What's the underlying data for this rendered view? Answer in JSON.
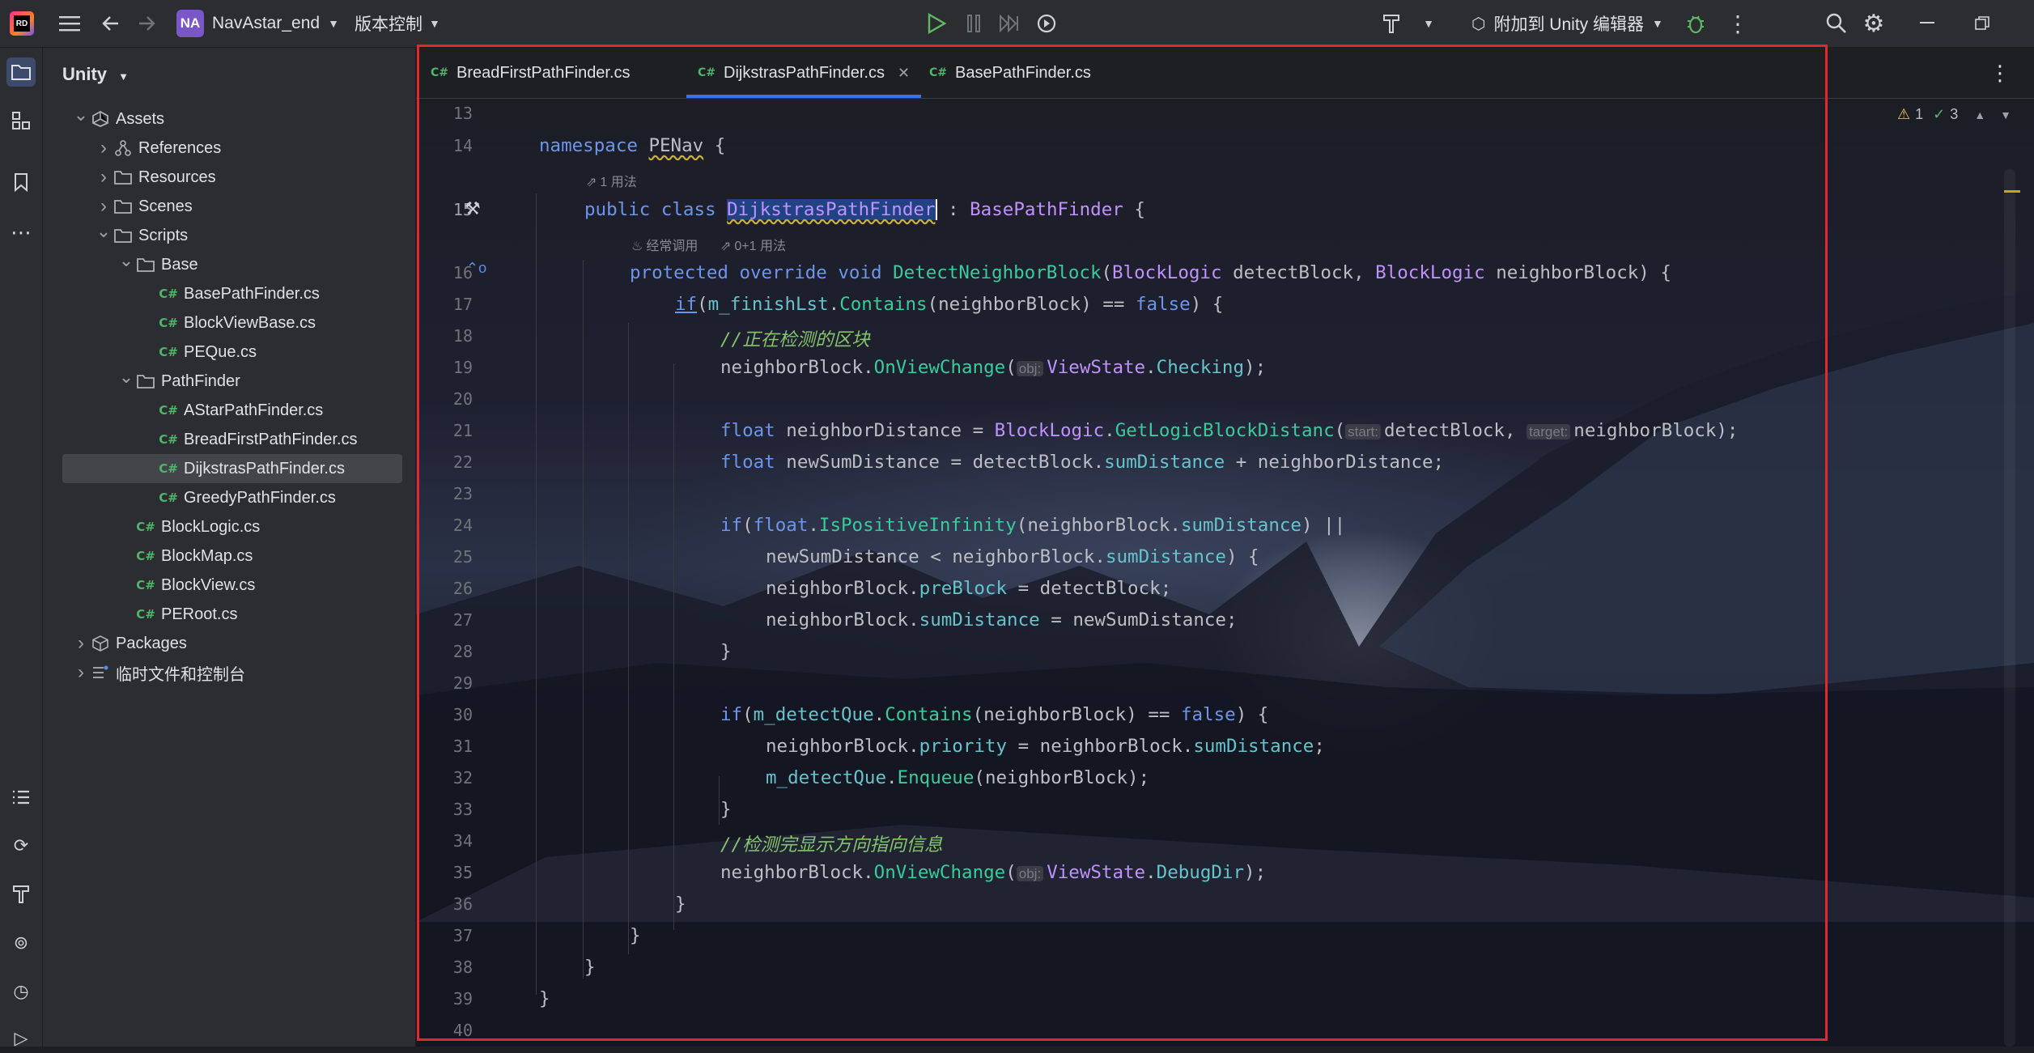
{
  "titlebar": {
    "logo_text": "RD",
    "project_badge": "NA",
    "project_name": "NavAstar_end",
    "vcs_label": "版本控制",
    "attach_label": "附加到 Unity 编辑器"
  },
  "project_panel": {
    "header": "Unity",
    "tree": [
      {
        "label": "Assets",
        "level": 0,
        "expanded": true,
        "icon": "unity-icon"
      },
      {
        "label": "References",
        "level": 1,
        "expanded": false,
        "icon": "references-icon"
      },
      {
        "label": "Resources",
        "level": 1,
        "expanded": false,
        "icon": "folder-icon"
      },
      {
        "label": "Scenes",
        "level": 1,
        "expanded": false,
        "icon": "folder-icon"
      },
      {
        "label": "Scripts",
        "level": 1,
        "expanded": true,
        "icon": "folder-icon"
      },
      {
        "label": "Base",
        "level": 2,
        "expanded": true,
        "icon": "folder-icon"
      },
      {
        "label": "BasePathFinder.cs",
        "level": 3,
        "icon": "csharp-file-icon"
      },
      {
        "label": "BlockViewBase.cs",
        "level": 3,
        "icon": "csharp-file-icon"
      },
      {
        "label": "PEQue.cs",
        "level": 3,
        "icon": "csharp-file-icon"
      },
      {
        "label": "PathFinder",
        "level": 2,
        "expanded": true,
        "icon": "folder-icon"
      },
      {
        "label": "AStarPathFinder.cs",
        "level": 3,
        "icon": "csharp-file-icon"
      },
      {
        "label": "BreadFirstPathFinder.cs",
        "level": 3,
        "icon": "csharp-file-icon"
      },
      {
        "label": "DijkstrasPathFinder.cs",
        "level": 3,
        "icon": "csharp-file-icon",
        "selected": true
      },
      {
        "label": "GreedyPathFinder.cs",
        "level": 3,
        "icon": "csharp-file-icon"
      },
      {
        "label": "BlockLogic.cs",
        "level": 2,
        "icon": "csharp-file-icon"
      },
      {
        "label": "BlockMap.cs",
        "level": 2,
        "icon": "csharp-file-icon"
      },
      {
        "label": "BlockView.cs",
        "level": 2,
        "icon": "csharp-file-icon"
      },
      {
        "label": "PERoot.cs",
        "level": 2,
        "icon": "csharp-file-icon"
      },
      {
        "label": "Packages",
        "level": 0,
        "expanded": false,
        "icon": "packages-icon"
      },
      {
        "label": "临时文件和控制台",
        "level": 0,
        "expanded": false,
        "icon": "scratches-icon"
      }
    ]
  },
  "tabs": [
    {
      "label": "BreadFirstPathFinder.cs",
      "lang": "C#"
    },
    {
      "label": "DijkstrasPathFinder.cs",
      "lang": "C#",
      "active": true
    },
    {
      "label": "BasePathFinder.cs",
      "lang": "C#"
    }
  ],
  "inspections": {
    "warnings": "1",
    "ok": "3"
  },
  "hints": {
    "usages_class": "1 用法",
    "freq_called": "经常调用",
    "usages_method": "0+1 用法"
  },
  "line_numbers": [
    "13",
    "14",
    "15",
    "16",
    "17",
    "18",
    "19",
    "20",
    "21",
    "22",
    "23",
    "24",
    "25",
    "26",
    "27",
    "28",
    "29",
    "30",
    "31",
    "32",
    "33",
    "34",
    "35",
    "36",
    "37",
    "38",
    "39",
    "40"
  ],
  "code": {
    "l14_kw": "namespace",
    "l14_ns": "PENav",
    "l15_kw": "public class",
    "l15_cls": "DijkstrasPathFinder",
    "l15_base": "BasePathFinder",
    "l16_kw": "protected override void",
    "l16_fn": "DetectNeighborBlock",
    "l16_t1": "BlockLogic",
    "l16_p1": "detectBlock",
    "l16_t2": "BlockLogic",
    "l16_p2": "neighborBlock",
    "l17_field": "m_finishLst",
    "l17_fn": "Contains",
    "l17_arg": "neighborBlock",
    "l17_false": "false",
    "l18_comment": "//正在检测的区块",
    "l19_var": "neighborBlock",
    "l19_fn": "OnViewChange",
    "l19_hint": "obj:",
    "l19_type": "ViewState",
    "l19_enum": "Checking",
    "l21_kw": "float",
    "l21_var": "neighborDistance",
    "l21_type": "BlockLogic",
    "l21_fn": "GetLogicBlockDistanc",
    "l21_h1": "start:",
    "l21_a1": "detectBlock",
    "l21_h2": "target:",
    "l21_a2": "neighborBlock",
    "l22_kw": "float",
    "l22_var": "newSumDistance",
    "l22_a": "detectBlock",
    "l22_f": "sumDistance",
    "l22_b": "neighborDistance",
    "l24_kw": "float",
    "l24_fn": "IsPositiveInfinity",
    "l24_a": "neighborBlock",
    "l24_f": "sumDistance",
    "l25_a": "newSumDistance",
    "l25_b": "neighborBlock",
    "l25_f": "sumDistance",
    "l26_a": "neighborBlock",
    "l26_f": "preBlock",
    "l26_b": "detectBlock",
    "l27_a": "neighborBlock",
    "l27_f": "sumDistance",
    "l27_b": "newSumDistance",
    "l30_field": "m_detectQue",
    "l30_fn": "Contains",
    "l30_arg": "neighborBlock",
    "l30_false": "false",
    "l31_a": "neighborBlock",
    "l31_f": "priority",
    "l31_b": "neighborBlock",
    "l31_f2": "sumDistance",
    "l32_field": "m_detectQue",
    "l32_fn": "Enqueue",
    "l32_arg": "neighborBlock",
    "l34_comment": "//检测完显示方向指向信息",
    "l35_var": "neighborBlock",
    "l35_fn": "OnViewChange",
    "l35_hint": "obj:",
    "l35_type": "ViewState",
    "l35_enum": "DebugDir"
  },
  "colors": {
    "keyword": "#6c95eb",
    "type": "#c191ff",
    "method": "#39cc9b",
    "comment": "#85c46c",
    "field": "#66c3cc",
    "highlight_box": "#e0282e",
    "active_tab_underline": "#3574f0"
  }
}
